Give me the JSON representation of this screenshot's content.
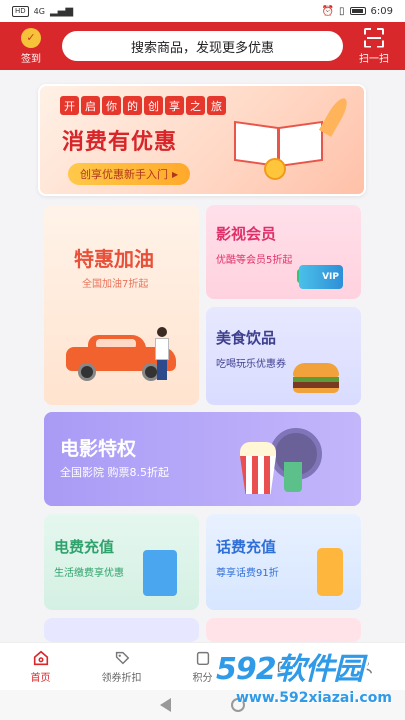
{
  "statusbar": {
    "net_badge": "HD",
    "net_type": "4G",
    "time": "6:09"
  },
  "header": {
    "signin_label": "签到",
    "search_placeholder": "搜索商品，发现更多优惠",
    "scan_label": "扫一扫"
  },
  "banner": {
    "chips": [
      "开",
      "启",
      "你",
      "的",
      "创",
      "享",
      "之",
      "旅"
    ],
    "title": "消费有优惠",
    "button_label": "创享优惠新手入门",
    "button_arrow": "▶"
  },
  "cards": {
    "fuel": {
      "title": "特惠加油",
      "subtitle": "全国加油7折起",
      "title_color": "#e8503a"
    },
    "video": {
      "title": "影视会员",
      "subtitle": "优酷等会员5折起",
      "vip_text": "VIP",
      "title_color": "#e0306a"
    },
    "food": {
      "title": "美食饮品",
      "subtitle": "吃喝玩乐优惠券",
      "title_color": "#3f3f8f"
    },
    "movie": {
      "title": "电影特权",
      "subtitle": "全国影院  购票8.5折起",
      "title_color": "#ffffff"
    },
    "power": {
      "title": "电费充值",
      "subtitle": "生活缴费享优惠",
      "title_color": "#2fa36b"
    },
    "phone": {
      "title": "话费充值",
      "subtitle": "尊享话费91折",
      "title_color": "#2f6fd8"
    }
  },
  "tabbar": {
    "items": [
      {
        "label": "首页",
        "icon": "home-icon",
        "active": true
      },
      {
        "label": "领券折扣",
        "icon": "coupon-icon",
        "active": false
      },
      {
        "label": "积分",
        "icon": "points-icon",
        "active": false
      },
      {
        "label": "",
        "icon": "shop-icon",
        "active": false
      },
      {
        "label": "",
        "icon": "user-icon",
        "active": false
      }
    ]
  },
  "watermark": {
    "main": "592软件园",
    "url": "www.592xiazai.com"
  }
}
